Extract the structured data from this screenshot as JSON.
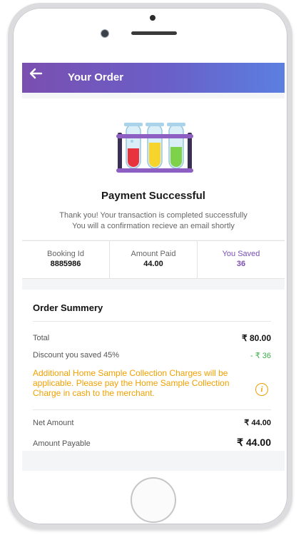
{
  "appbar": {
    "title": "Your Order",
    "back_icon": "arrow-left-icon"
  },
  "hero": {
    "illustration": "test-tubes-icon",
    "title": "Payment Successful",
    "message_line1": "Thank you! Your transaction is completed successfully",
    "message_line2": "You will a confirmation recieve an email shortly"
  },
  "stats": [
    {
      "label": "Booking Id",
      "value": "8885986"
    },
    {
      "label": "Amount Paid",
      "value": "44.00"
    },
    {
      "label": "You Saved",
      "value": "36"
    }
  ],
  "summary": {
    "title": "Order Summery",
    "total_label": "Total",
    "total_value": "₹ 80.00",
    "discount_label": "Discount you saved 45%",
    "discount_value": "- ₹ 36",
    "note": "Additional Home Sample Collection Charges will be applicable. Please pay the Home Sample Collection Charge in cash to the merchant.",
    "info_icon": "i",
    "net_label": "Net Amount",
    "net_value": "₹ 44.00",
    "payable_label": "Amount Payable",
    "payable_value": "₹ 44.00"
  },
  "colors": {
    "accent": "#7a4fb0",
    "accent_end": "#5b7fe0",
    "success": "#3cae4a",
    "warning": "#f0a000"
  }
}
